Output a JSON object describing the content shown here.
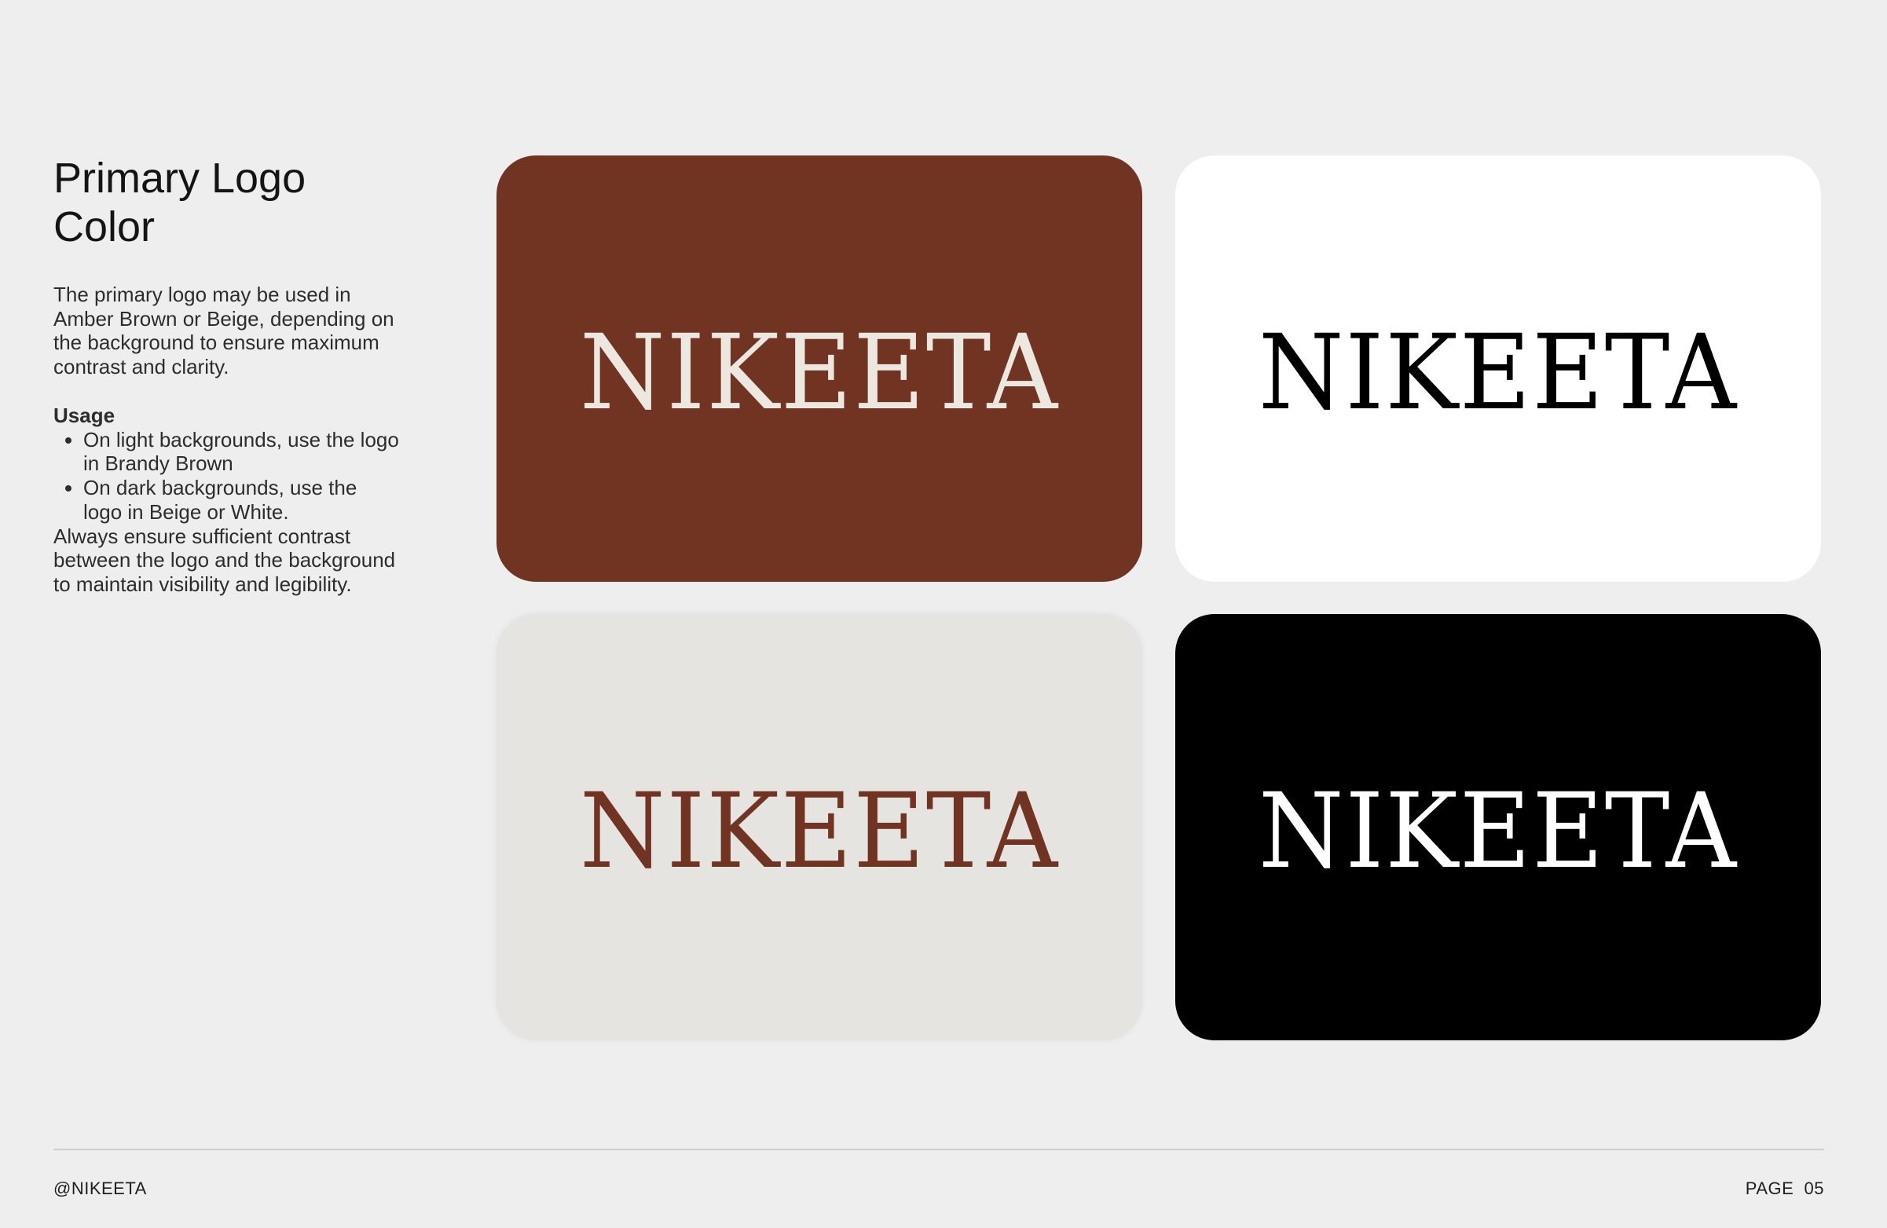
{
  "page": {
    "title_line1": "Primary Logo",
    "title_line2": "Color",
    "description": "The primary logo may be used in Amber Brown or Beige, depending on the background to ensure maximum contrast and clarity.",
    "usage_heading": "Usage",
    "usage_items": [
      "On light backgrounds, use the logo in Brandy Brown",
      "On dark backgrounds, use the logo in Beige or White."
    ],
    "usage_note": "Always ensure sufficient contrast between the logo and the background to maintain visibility and legibility."
  },
  "logo_cards": [
    {
      "wordmark": "NIKEETA",
      "background": "#713423",
      "logo_color": "#ECE7DF"
    },
    {
      "wordmark": "NIKEETA",
      "background": "#FFFFFF",
      "logo_color": "#000000"
    },
    {
      "wordmark": "NIKEETA",
      "background": "#E5E4E0",
      "logo_color": "#713423"
    },
    {
      "wordmark": "NIKEETA",
      "background": "#000000",
      "logo_color": "#FFFFFF"
    }
  ],
  "footer": {
    "handle": "@NIKEETA",
    "page_label": "PAGE  05"
  }
}
